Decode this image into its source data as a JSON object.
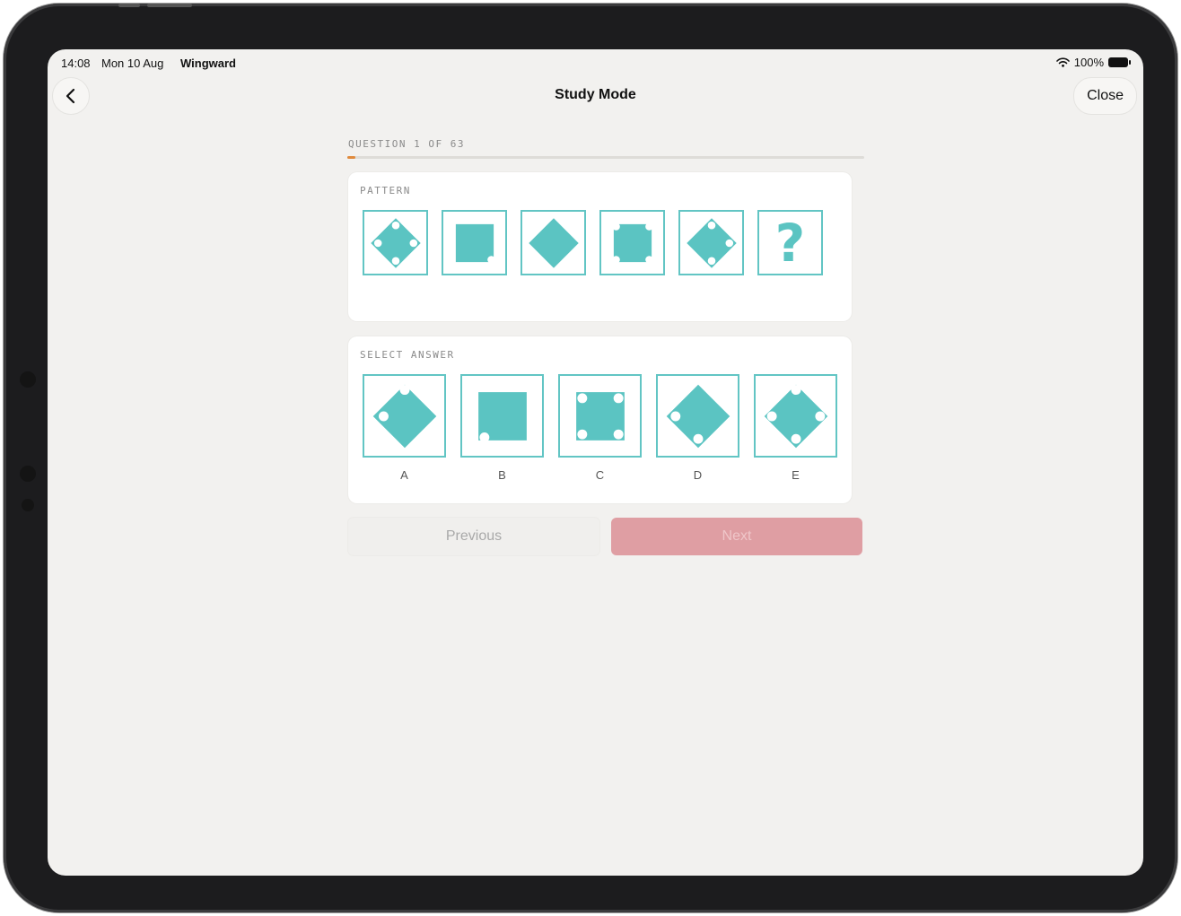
{
  "status_bar": {
    "time": "14:08",
    "date": "Mon 10 Aug",
    "app": "Wingward",
    "battery": "100%"
  },
  "nav": {
    "title": "Study Mode",
    "close_label": "Close"
  },
  "question": {
    "label": "QUESTION 1 OF 63",
    "current": 1,
    "total": 63
  },
  "pattern": {
    "label": "PATTERN",
    "tiles": [
      "diamond",
      "square",
      "diamond",
      "square",
      "diamond",
      "question-mark"
    ],
    "question_glyph": "?"
  },
  "answers": {
    "label": "SELECT ANSWER",
    "options": [
      {
        "letter": "A",
        "shape": "diamond"
      },
      {
        "letter": "B",
        "shape": "square"
      },
      {
        "letter": "C",
        "shape": "square"
      },
      {
        "letter": "D",
        "shape": "diamond"
      },
      {
        "letter": "E",
        "shape": "diamond"
      }
    ]
  },
  "buttons": {
    "previous": "Previous",
    "next": "Next"
  },
  "colors": {
    "accent_teal": "#5bc4c2",
    "progress": "#e08a3c",
    "next_button": "#df9ea3"
  }
}
